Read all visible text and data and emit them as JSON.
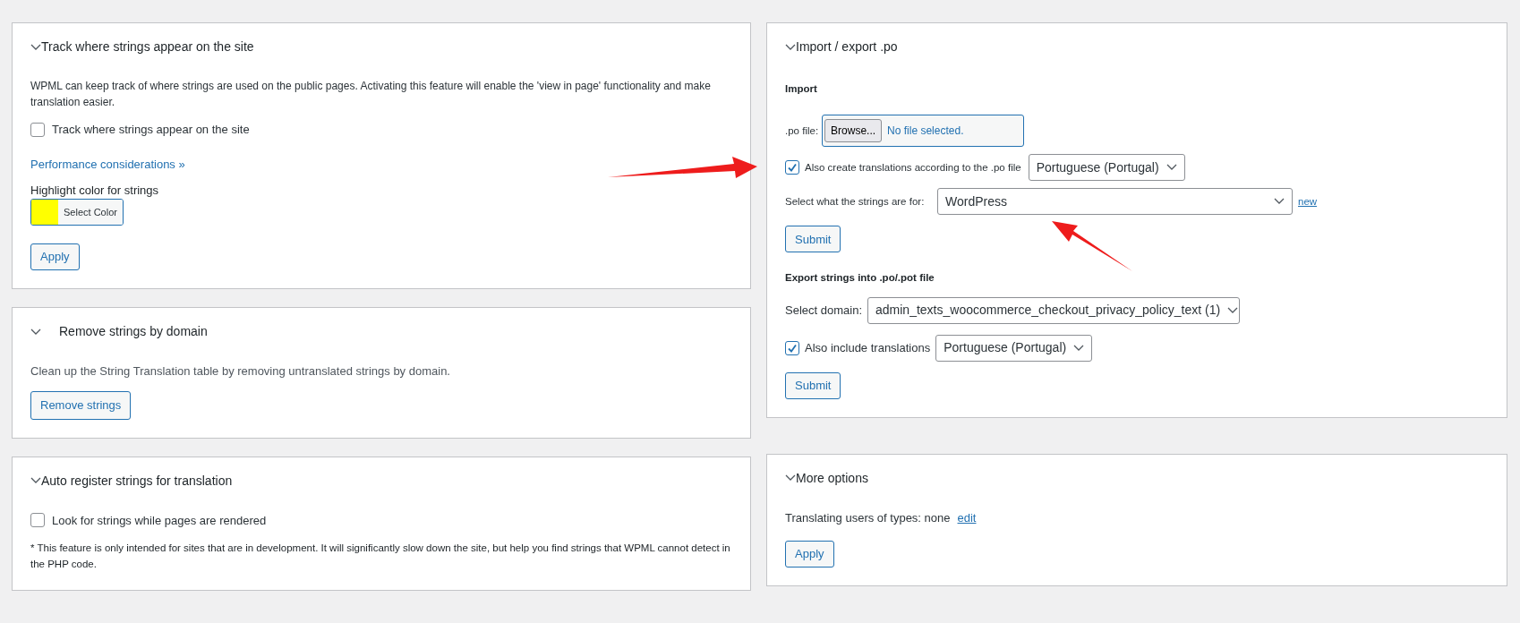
{
  "left_panels": [
    {
      "kind": "track",
      "title": "Track where strings appear on the site",
      "description": "WPML can keep track of where strings are used on the public pages. Activating this feature will enable the 'view in page' functionality and make translation easier.",
      "checkbox": {
        "label": "Track where strings appear on the site",
        "checked": false
      },
      "link": "Performance considerations »",
      "color_label": "Highlight color for strings",
      "color": "#ffff00",
      "color_button": "Select Color",
      "button": "Apply"
    },
    {
      "kind": "remove",
      "title": "Remove strings by domain",
      "description": "Clean up the String Translation table by removing untranslated strings by domain.",
      "button": "Remove strings"
    },
    {
      "kind": "auto",
      "title": "Auto register strings for translation",
      "checkbox": {
        "label": "Look for strings while pages are rendered",
        "checked": false
      },
      "note": "* This feature is only intended for sites that are in development. It will significantly slow down the site, but help you find strings that WPML cannot detect in the PHP code."
    }
  ],
  "import_export": {
    "title": "Import / export .po",
    "import_heading": "Import",
    "file_label": ".po file:",
    "browse_button": "Browse...",
    "file_status": "No file selected.",
    "create_translations": {
      "label": "Also create translations according to the .po file",
      "checked": true,
      "language": "Portuguese (Portugal)"
    },
    "strings_for_label": "Select what the strings are for:",
    "strings_for_value": "WordPress",
    "new_link": "new",
    "import_submit": "Submit",
    "export_heading": "Export strings into .po/.pot file",
    "domain_label": "Select domain:",
    "domain_value": "admin_texts_woocommerce_checkout_privacy_policy_text (1)",
    "include_translations": {
      "label": "Also include translations",
      "checked": true,
      "language": "Portuguese (Portugal)"
    },
    "export_submit": "Submit"
  },
  "more_options": {
    "title": "More options",
    "users_text": "Translating users of types: none",
    "edit_link": "edit",
    "button": "Apply"
  }
}
